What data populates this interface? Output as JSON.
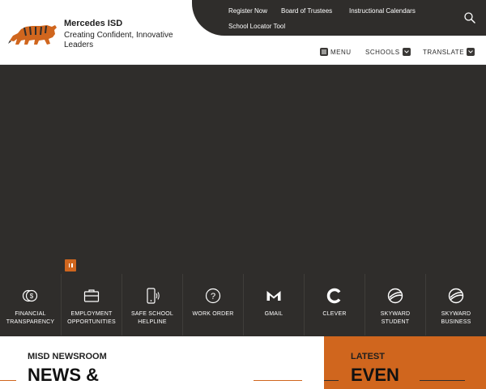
{
  "brand": {
    "title": "Mercedes ISD",
    "tagline": "Creating Confident, Innovative Leaders",
    "logo_icon": "tiger-logo-icon"
  },
  "utility_links": [
    "Register Now",
    "Board of Trustees",
    "Instructional Calendars",
    "School Locator Tool"
  ],
  "nav": {
    "menu": "MENU",
    "schools": "SCHOOLS",
    "translate": "TRANSLATE"
  },
  "quick_links": [
    {
      "label": "FINANCIAL TRANSPARENCY",
      "icon": "coins-icon"
    },
    {
      "label": "EMPLOYMENT OPPORTUNITIES",
      "icon": "briefcase-icon"
    },
    {
      "label": "SAFE SCHOOL HELPLINE",
      "icon": "phone-icon"
    },
    {
      "label": "WORK ORDER",
      "icon": "question-icon"
    },
    {
      "label": "GMAIL",
      "icon": "gmail-icon"
    },
    {
      "label": "CLEVER",
      "icon": "clever-icon"
    },
    {
      "label": "SKYWARD STUDENT",
      "icon": "skyward-icon"
    },
    {
      "label": "SKYWARD BUSINESS",
      "icon": "skyward-icon"
    }
  ],
  "newsroom": {
    "kicker": "MISD NEWSROOM",
    "heading": "NEWS &"
  },
  "events": {
    "kicker": "LATEST",
    "heading": "EVEN"
  },
  "colors": {
    "accent": "#d0661e",
    "dark": "#2f2d2b",
    "white": "#ffffff"
  }
}
